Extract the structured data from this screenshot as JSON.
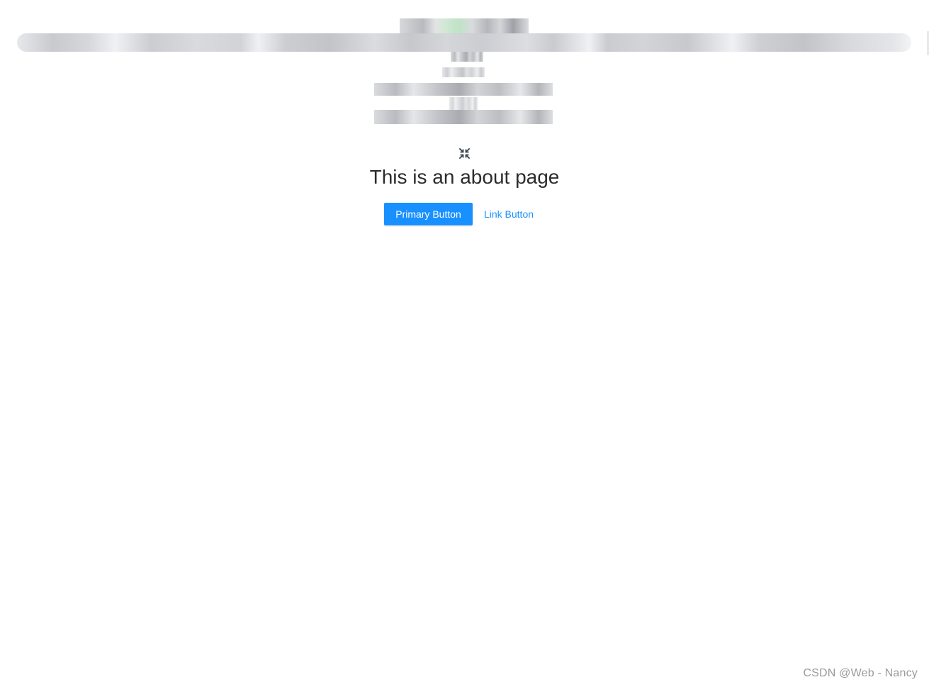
{
  "header": {
    "obscured": true
  },
  "main": {
    "title": "This is an about page",
    "fullscreen_icon": "fullscreen-exit-icon",
    "primary_button_label": "Primary Button",
    "link_button_label": "Link Button"
  },
  "watermark": {
    "text": "CSDN @Web - Nancy"
  },
  "colors": {
    "accent": "#1890ff",
    "title_text": "#2c2c2c",
    "watermark_text": "#9a9a9a",
    "background": "#ffffff"
  }
}
